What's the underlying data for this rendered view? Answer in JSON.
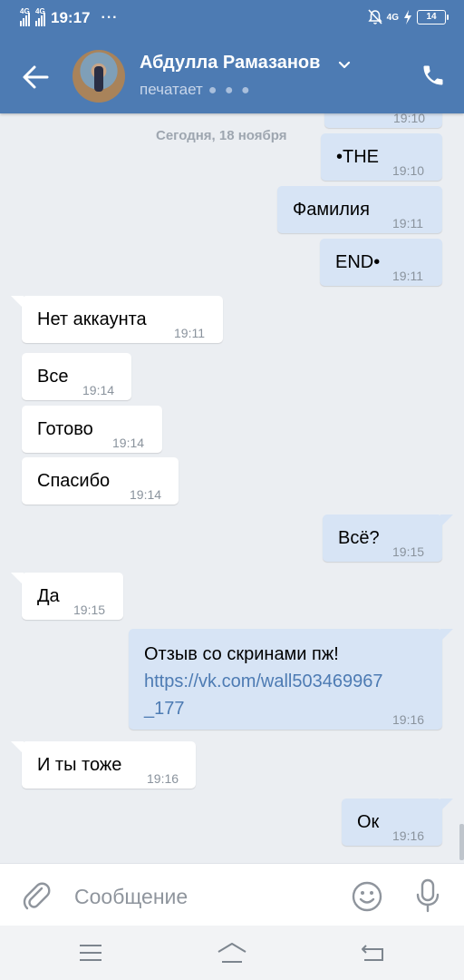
{
  "status_bar": {
    "network_1": "4G",
    "network_2": "4G",
    "time": "19:17",
    "dots": "···",
    "network_3": "4G",
    "battery": "14"
  },
  "header": {
    "contact_name": "Абдулла Рамазанов",
    "status": "печатает"
  },
  "date_separator": "Сегодня, 18 ноября",
  "messages": [
    {
      "text": "•THE",
      "time": "19:10",
      "direction": "out"
    },
    {
      "text": "Фамилия",
      "time": "19:11",
      "direction": "out"
    },
    {
      "text": "END•",
      "time": "19:11",
      "direction": "out"
    },
    {
      "text": "Нет аккаунта",
      "time": "19:11",
      "direction": "in"
    },
    {
      "text": "Все",
      "time": "19:14",
      "direction": "in"
    },
    {
      "text": "Готово",
      "time": "19:14",
      "direction": "in"
    },
    {
      "text": "Спасибо",
      "time": "19:14",
      "direction": "in"
    },
    {
      "text": "Всё?",
      "time": "19:15",
      "direction": "out"
    },
    {
      "text": "Да",
      "time": "19:15",
      "direction": "in"
    },
    {
      "text_line1": "Отзыв со скринами пж!",
      "link_line1": "https://vk.com/wall503469967",
      "link_line2": "_177",
      "time": "19:16",
      "direction": "out"
    },
    {
      "text": "И ты тоже",
      "time": "19:16",
      "direction": "in"
    },
    {
      "text": "Ок",
      "time": "19:16",
      "direction": "out"
    }
  ],
  "top_partial_time": "19:10",
  "composer": {
    "placeholder": "Сообщение"
  },
  "icons": {
    "back": "arrow-left",
    "call": "phone",
    "attach": "paperclip",
    "emoji": "smiley",
    "mic": "microphone",
    "nav_menu": "hamburger",
    "nav_home": "home",
    "nav_back": "return"
  },
  "colors": {
    "header": "#4d7bb3",
    "outgoing_bubble": "#d7e4f5",
    "incoming_bubble": "#ffffff",
    "background": "#ebeef2",
    "link": "#4d7bb3"
  }
}
